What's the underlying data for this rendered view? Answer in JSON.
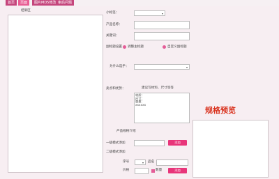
{
  "tabs": [
    "首页",
    "页面",
    "图片MD5修改",
    "审后问题"
  ],
  "left_panel": {
    "label": "结果区"
  },
  "form": {
    "small_tag_label": "小标签：",
    "product_name_label": "产品名称：",
    "keywords_label": "关键词：",
    "title_setting_label": "副标题设置",
    "radio_1": "调整主标题",
    "radio_2": "自定义副标题",
    "why_choose_label": "为什么选手：",
    "selling_points_label": "卖点和优势：",
    "suggestion_text": "建议写材料、尺寸等等",
    "textarea_content": "材质：\n尺寸：\n重量：\nxxxxxx",
    "specs_intro_label": "产品规格介绍",
    "level1_add_label": "一级模式添加",
    "level2_add_label": "二级模式添加",
    "serial_label": "序号",
    "name_label": "品名",
    "price_label": "价格",
    "stock_label": "数量",
    "add_button": "添加"
  },
  "preview": {
    "title": "规格预览"
  },
  "colors": {
    "accent": "#e8357a",
    "tab": "#c5457c",
    "preview_title": "#d9331f"
  }
}
